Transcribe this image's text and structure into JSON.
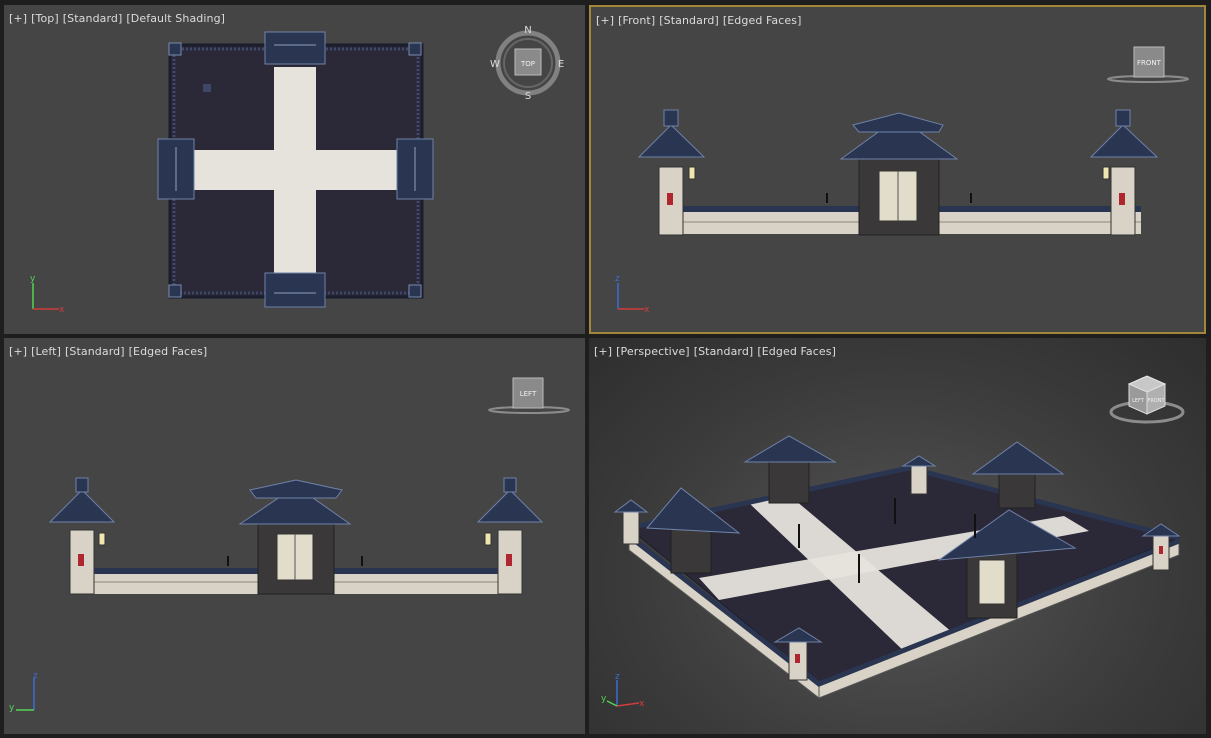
{
  "viewports": {
    "top": {
      "label": {
        "plus": "[+]",
        "view": "[Top]",
        "style": "[Standard]",
        "shading": "[Default Shading]"
      },
      "compass": {
        "n": "N",
        "s": "S",
        "e": "E",
        "w": "W",
        "cube": "TOP"
      },
      "axes": {
        "x": "x",
        "y": "y"
      }
    },
    "front": {
      "active": true,
      "label": {
        "plus": "[+]",
        "view": "[Front]",
        "style": "[Standard]",
        "shading": "[Edged Faces]"
      },
      "cube": "FRONT",
      "axes": {
        "x": "x",
        "z": "z"
      }
    },
    "left": {
      "label": {
        "plus": "[+]",
        "view": "[Left]",
        "style": "[Standard]",
        "shading": "[Edged Faces]"
      },
      "cube": "LEFT",
      "axes": {
        "y": "y",
        "z": "z"
      }
    },
    "perspective": {
      "label": {
        "plus": "[+]",
        "view": "[Perspective]",
        "style": "[Standard]",
        "shading": "[Edged Faces]"
      },
      "cube_faces": {
        "front": "FRONT",
        "left": "LEFT"
      },
      "axes": {
        "x": "x",
        "y": "y",
        "z": "z"
      }
    }
  },
  "colors": {
    "viewport_bg": "#454545",
    "active_border": "#a2873a",
    "roof": "#2a3551",
    "roof_highlight": "#6f82a8",
    "floor": "#2b2838",
    "path": "#e6e3dc",
    "wall": "#d9d3c7",
    "accent_red": "#b0262e"
  }
}
